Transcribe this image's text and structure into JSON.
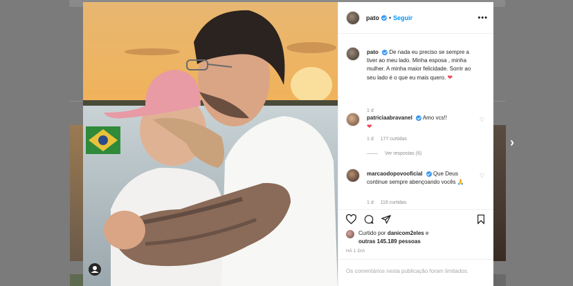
{
  "post": {
    "author": "pato",
    "follow_sep": "•",
    "follow_label": "Seguir",
    "more_label": "•••"
  },
  "caption": {
    "author": "pato",
    "text": "De nada eu preciso se sempre a tiver ao meu lado. Minha esposa , minha mulher. A minha maior felicidade. Sorrir ao seu lado é o que eu mais quero.",
    "heart": "❤",
    "age": "1 d"
  },
  "comments": [
    {
      "author": "patriciaabravanel",
      "text": "Amo vcs!!",
      "heart": "❤",
      "age": "1 d",
      "likes": "177 curtidas",
      "replies": "Ver respostas (6)"
    },
    {
      "author": "marcaodopovooficial",
      "text": "Que Deus continue sempre abençoando vocês",
      "emoji": "🙏",
      "age": "1 d",
      "likes": "116 curtidas"
    }
  ],
  "likes": {
    "prefix": "Curtido por",
    "user": "danicom2eles",
    "mid": "e",
    "rest": "outras 145.189 pessoas"
  },
  "time_ago": "HÁ 1 DIA",
  "comments_limited": "Os comentários nesta publicação foram limitados.",
  "icons": {
    "like": "heart-outline-icon",
    "comment": "comment-icon",
    "share": "share-icon",
    "save": "bookmark-icon",
    "next": "chevron-right-icon",
    "profile": "user-icon"
  },
  "colors": {
    "link": "#0095f6",
    "verified": "#3897f0",
    "heart_red": "#ed4956",
    "backdrop": "#7b7b7b"
  }
}
